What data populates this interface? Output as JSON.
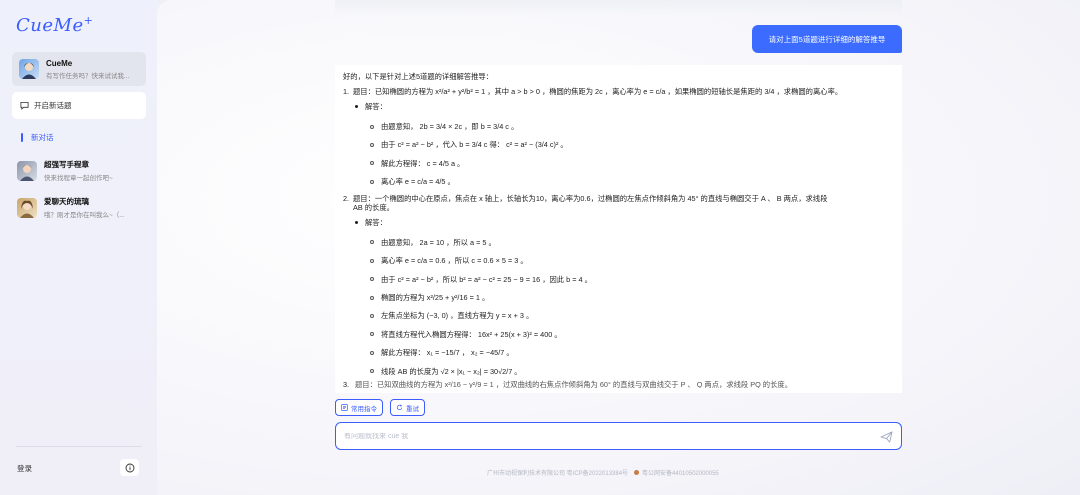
{
  "app": {
    "logo_text": "CueMe",
    "logo_plus": "+",
    "accent_color": "#3b6cff"
  },
  "sidebar": {
    "current_bot": {
      "name": "CueMe",
      "subtitle": "有写作任务吗？快来试试我..."
    },
    "new_chat_label": "开启新话题",
    "active_session_label": "新对话",
    "chats": [
      {
        "name": "超强写手程章",
        "subtitle": "快来找程章一起创作吧~"
      },
      {
        "name": "爱聊天的琉璃",
        "subtitle": "哦？刚才是你在叫我么~（..."
      }
    ],
    "login_label": "登录",
    "info_icon": "info-icon"
  },
  "conversation": {
    "user_message": "请对上面5道题进行详细的解答推导",
    "answer": {
      "intro": "好的，以下是针对上述5道题的详细解答推导：",
      "q1": "题目：已知椭圆的方程为 x²/a² + y²/b² = 1 ，其中 a > b > 0 ，椭圆的焦距为 2c ，离心率为 e = c/a ，如果椭圆的短轴长是焦距的 3/4 ，求椭圆的离心率。",
      "q1_solution_label": "解答：",
      "q1_steps": [
        "由题意知， 2b = 3/4 × 2c ，即 b = 3/4 c 。",
        "由于 c² = a² − b² ，代入 b = 3/4 c 得： c² = a² − (3/4 c)² 。",
        "解此方程得： c = 4/5 a 。",
        "离心率 e = c/a = 4/5 。"
      ],
      "q2_line1": "题目：一个椭圆的中心在原点，焦点在 x 轴上，长轴长为10，离心率为0.6，过椭圆的左焦点作倾斜角为 45° 的直线与椭圆交于 A 、 B 两点，求线段",
      "q2_line2": "AB 的长度。",
      "q2_solution_label": "解答：",
      "q2_steps": [
        "由题意知， 2a = 10 ，所以 a = 5 。",
        "离心率 e = c/a = 0.6 ，所以 c = 0.6 × 5 = 3 。",
        "由于 c² = a² − b² ，所以 b² = a² − c² = 25 − 9 = 16 ，因此 b = 4 。",
        "椭圆的方程为 x²/25 + y²/16 = 1 。",
        "左焦点坐标为 (−3, 0) ，直线方程为 y = x + 3 。",
        "将直线方程代入椭圆方程得： 16x² + 25(x + 3)² = 400 。",
        "解此方程得： x₁ = −15/7 ， x₂ = −45/7 。",
        "线段 AB 的长度为 √2 × |x₁ − x₂| = 30√2/7 。"
      ],
      "q3_partial": "题目：已知双曲线的方程为 x²/16 − y²/9 = 1 ，过双曲线的右焦点作倾斜角为 60° 的直线与双曲线交于 P 、 Q 两点，求线段 PQ 的长度。"
    }
  },
  "toolbar": {
    "common_commands_label": "常用指令",
    "retry_label": "重试"
  },
  "input": {
    "placeholder": "有问题就找来 cue 我"
  },
  "footer": {
    "company": "广州市动视保利技术有限公司 粤ICP备2022013384号",
    "police_record": "粤公网安备44010502000055"
  }
}
